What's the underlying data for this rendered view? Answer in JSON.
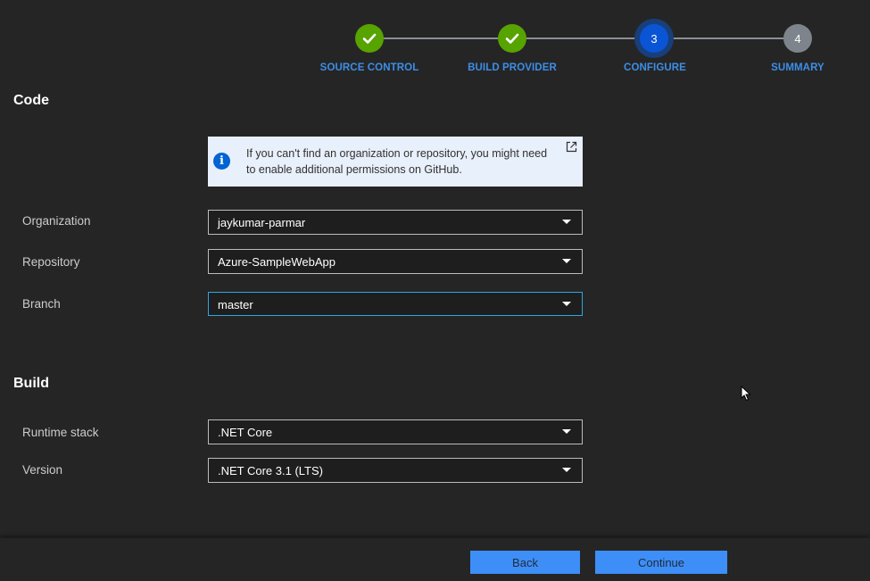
{
  "stepper": {
    "steps": [
      {
        "label": "SOURCE CONTROL",
        "state": "done",
        "number": ""
      },
      {
        "label": "BUILD PROVIDER",
        "state": "done",
        "number": ""
      },
      {
        "label": "CONFIGURE",
        "state": "active",
        "number": "3"
      },
      {
        "label": "SUMMARY",
        "state": "pending",
        "number": "4"
      }
    ]
  },
  "code_section": {
    "title": "Code",
    "info_message": "If you can't find an organization or repository, you might need to enable additional permissions on GitHub.",
    "organization": {
      "label": "Organization",
      "value": "jaykumar-parmar"
    },
    "repository": {
      "label": "Repository",
      "value": "Azure-SampleWebApp"
    },
    "branch": {
      "label": "Branch",
      "value": "master"
    }
  },
  "build_section": {
    "title": "Build",
    "runtime_stack": {
      "label": "Runtime stack",
      "value": ".NET Core"
    },
    "version": {
      "label": "Version",
      "value": ".NET Core 3.1 (LTS)"
    }
  },
  "footer": {
    "back_label": "Back",
    "continue_label": "Continue"
  },
  "colors": {
    "background": "#252526",
    "step_done": "#57a300",
    "step_active": "#0a55d6",
    "step_pending": "#7d848c",
    "accent_label": "#3d8ee6",
    "button": "#3e8ef7",
    "info_bg": "#e8f0fb"
  }
}
